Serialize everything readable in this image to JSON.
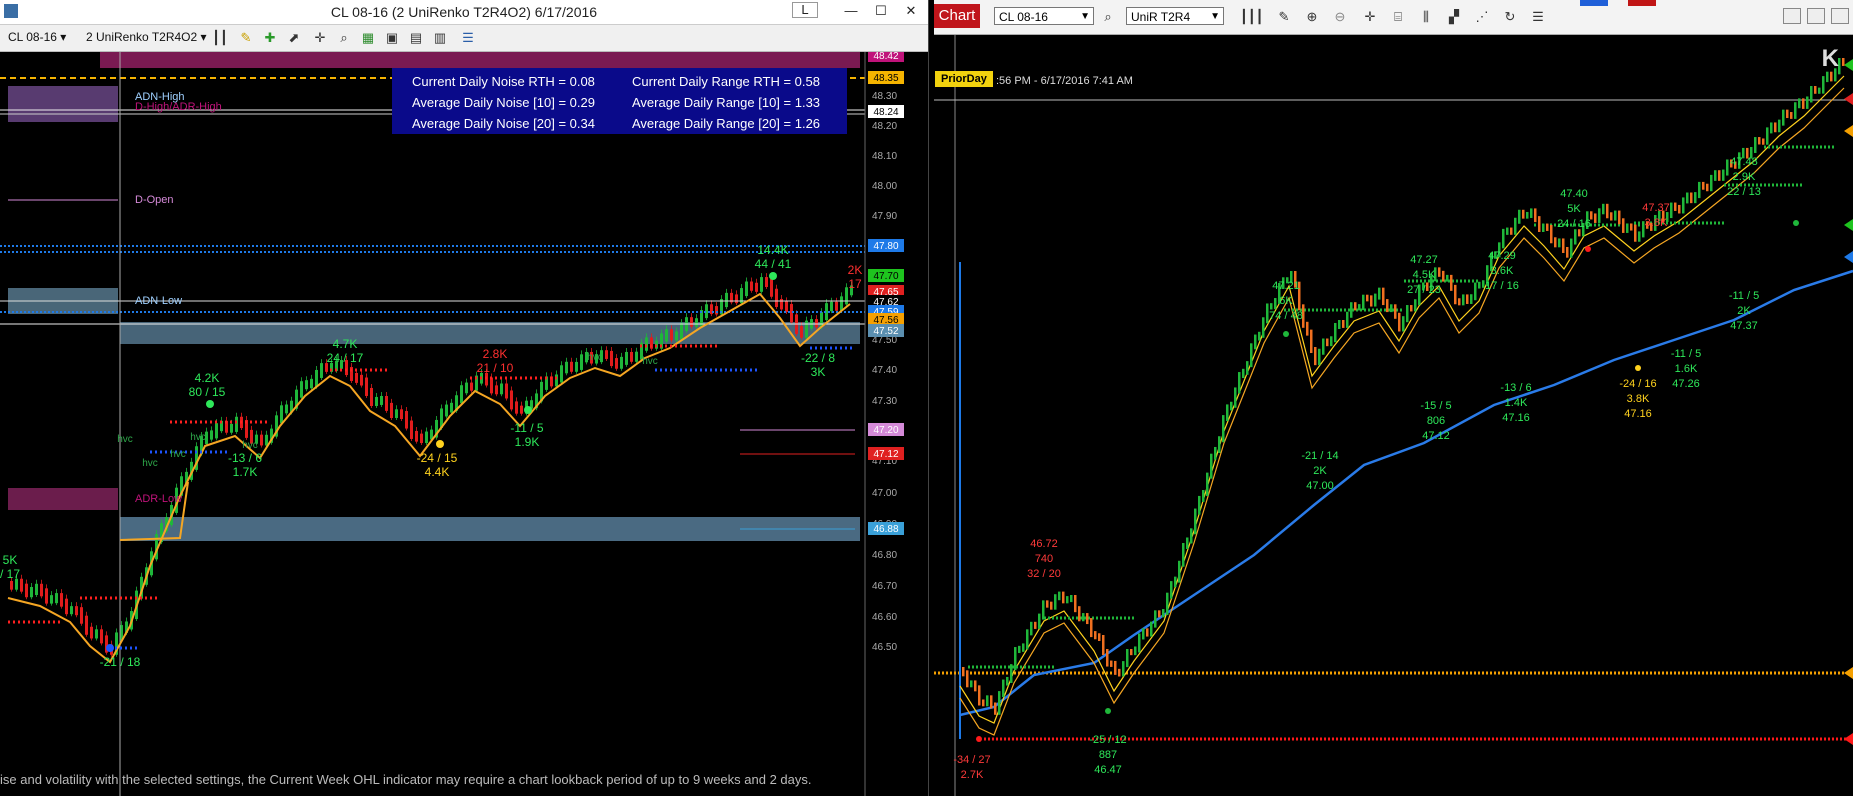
{
  "left": {
    "title": "CL 08-16 (2 UniRenko T2R4O2)  6/17/2016",
    "window_buttons": [
      "L",
      "—",
      "☐",
      "✕"
    ],
    "toolbar": {
      "instrument": "CL 08-16",
      "bar_type": "2 UniRenko T2R4O2"
    },
    "price_ticks": [
      "48.30",
      "48.20",
      "48.10",
      "48.00",
      "47.90",
      "47.70",
      "47.50",
      "47.40",
      "47.30",
      "47.10",
      "47.00",
      "46.90",
      "46.80",
      "46.70",
      "46.60",
      "46.50"
    ],
    "price_badges": [
      {
        "text": "48.42",
        "color": "#c0137a"
      },
      {
        "text": "48.35",
        "color": "#f5b400"
      },
      {
        "text": "48.24",
        "color": "#ffffff"
      },
      {
        "text": "47.80",
        "color": "#1e7ae8"
      },
      {
        "text": "47.70",
        "color": "#1ec41e"
      },
      {
        "text": "47.65",
        "color": "#e02020"
      },
      {
        "text": "47.62",
        "color": "#000000"
      },
      {
        "text": "47.59",
        "color": "#1e7ae8"
      },
      {
        "text": "47.56",
        "color": "#f5a000"
      },
      {
        "text": "47.52",
        "color": "#5b8fb0"
      },
      {
        "text": "47.20",
        "color": "#d58ad8"
      },
      {
        "text": "47.12",
        "color": "#e02020"
      },
      {
        "text": "46.88",
        "color": "#3aa0d8"
      }
    ],
    "stats": {
      "r1c1": "Current Daily Noise RTH = 0.08",
      "r1c2": "Current Daily Range RTH = 0.58",
      "r2c1": "Average Daily Noise [10] = 0.29",
      "r2c2": "Average Daily Range [10] = 1.33",
      "r3c1": "Average Daily Noise [20] = 0.34",
      "r3c2": "Average Daily Range [20] = 1.26"
    },
    "zone_labels": {
      "adn_high": "ADN-High",
      "dhigh": "D-High/ADR-High",
      "dopen": "D-Open",
      "adn_low": "ADN-Low",
      "adr_low": "ADR-Low"
    },
    "annotations": [
      {
        "line1": "4.7K",
        "line2": "24 / 17",
        "color": "#2ee85a"
      },
      {
        "line1": "4.2K",
        "line2": "80 / 15",
        "color": "#2ee85a"
      },
      {
        "line1": "2.8K",
        "line2": "21 / 10",
        "color": "#ff3030"
      },
      {
        "line1": "14.4K",
        "line2": "44 / 41",
        "color": "#2ee85a"
      },
      {
        "line1": "-13 / 6",
        "line2": "1.7K",
        "color": "#2ee85a"
      },
      {
        "line1": "-24 / 15",
        "line2": "4.4K",
        "color": "#ffd21e"
      },
      {
        "line1": "-11 / 5",
        "line2": "1.9K",
        "color": "#2ee85a"
      },
      {
        "line1": "-22 / 8",
        "line2": "3K",
        "color": "#2ee85a"
      },
      {
        "line1": "5K",
        "line2": "/ 17",
        "color": "#2ee85a"
      },
      {
        "line1": "-21 / 18",
        "line2": "",
        "color": "#2ee85a"
      },
      {
        "line1": "2K",
        "line2": "17",
        "color": "#ff3030"
      }
    ],
    "hvc_labels": [
      "hvc",
      "hvc",
      "hvc",
      "hvc",
      "hvc",
      "hvc",
      "hvc"
    ],
    "footer_message": "ise and volatility with the selected settings, the Current Week OHL indicator may require a chart lookback period of up to 9 weeks and 2 days."
  },
  "right": {
    "chart_tab": "Chart",
    "instrument": "CL 08-16",
    "bar_type": "UniR T2R4",
    "prior_day": "PriorDay",
    "timestamp": ":56 PM - 6/17/2016 7:41 AM",
    "annotations": [
      {
        "line1": "46.72",
        "line2": "740",
        "line3": "32 / 20",
        "color": "#ff3a3a"
      },
      {
        "line1": "47.21",
        "line2": "6K",
        "line3": "74 / 48",
        "color": "#2ee85a"
      },
      {
        "line1": "47.27",
        "line2": "4.5K",
        "line3": "27 / 23",
        "color": "#2ee85a"
      },
      {
        "line1": "47.29",
        "line2": "3.6K",
        "line3": "17 / 16",
        "color": "#2ee85a"
      },
      {
        "line1": "47.40",
        "line2": "5K",
        "line3": "24 / 16",
        "color": "#2ee85a"
      },
      {
        "line1": "47.37",
        "line2": "3.8K",
        "line3": "",
        "color": "#ff3a3a"
      },
      {
        "line1": "47.48",
        "line2": "2.9K",
        "line3": "22 / 13",
        "color": "#2ee85a"
      },
      {
        "line1": "-21 / 14",
        "line2": "2K",
        "line3": "47.00",
        "color": "#2ee85a"
      },
      {
        "line1": "-15 / 5",
        "line2": "806",
        "line3": "47.12",
        "color": "#2ee85a"
      },
      {
        "line1": "-13 / 6",
        "line2": "1.4K",
        "line3": "47.16",
        "color": "#2ee85a"
      },
      {
        "line1": "-24 / 16",
        "line2": "3.8K",
        "line3": "47.16",
        "color": "#ffd21e"
      },
      {
        "line1": "-11 / 5",
        "line2": "1.6K",
        "line3": "47.26",
        "color": "#2ee85a"
      },
      {
        "line1": "-11 / 5",
        "line2": "2K",
        "line3": "47.37",
        "color": "#2ee85a"
      },
      {
        "line1": "-25 / 12",
        "line2": "887",
        "line3": "46.47",
        "color": "#2ee85a"
      },
      {
        "line1": "-34 / 27",
        "line2": "2.7K",
        "line3": "",
        "color": "#ff3a3a"
      }
    ]
  }
}
